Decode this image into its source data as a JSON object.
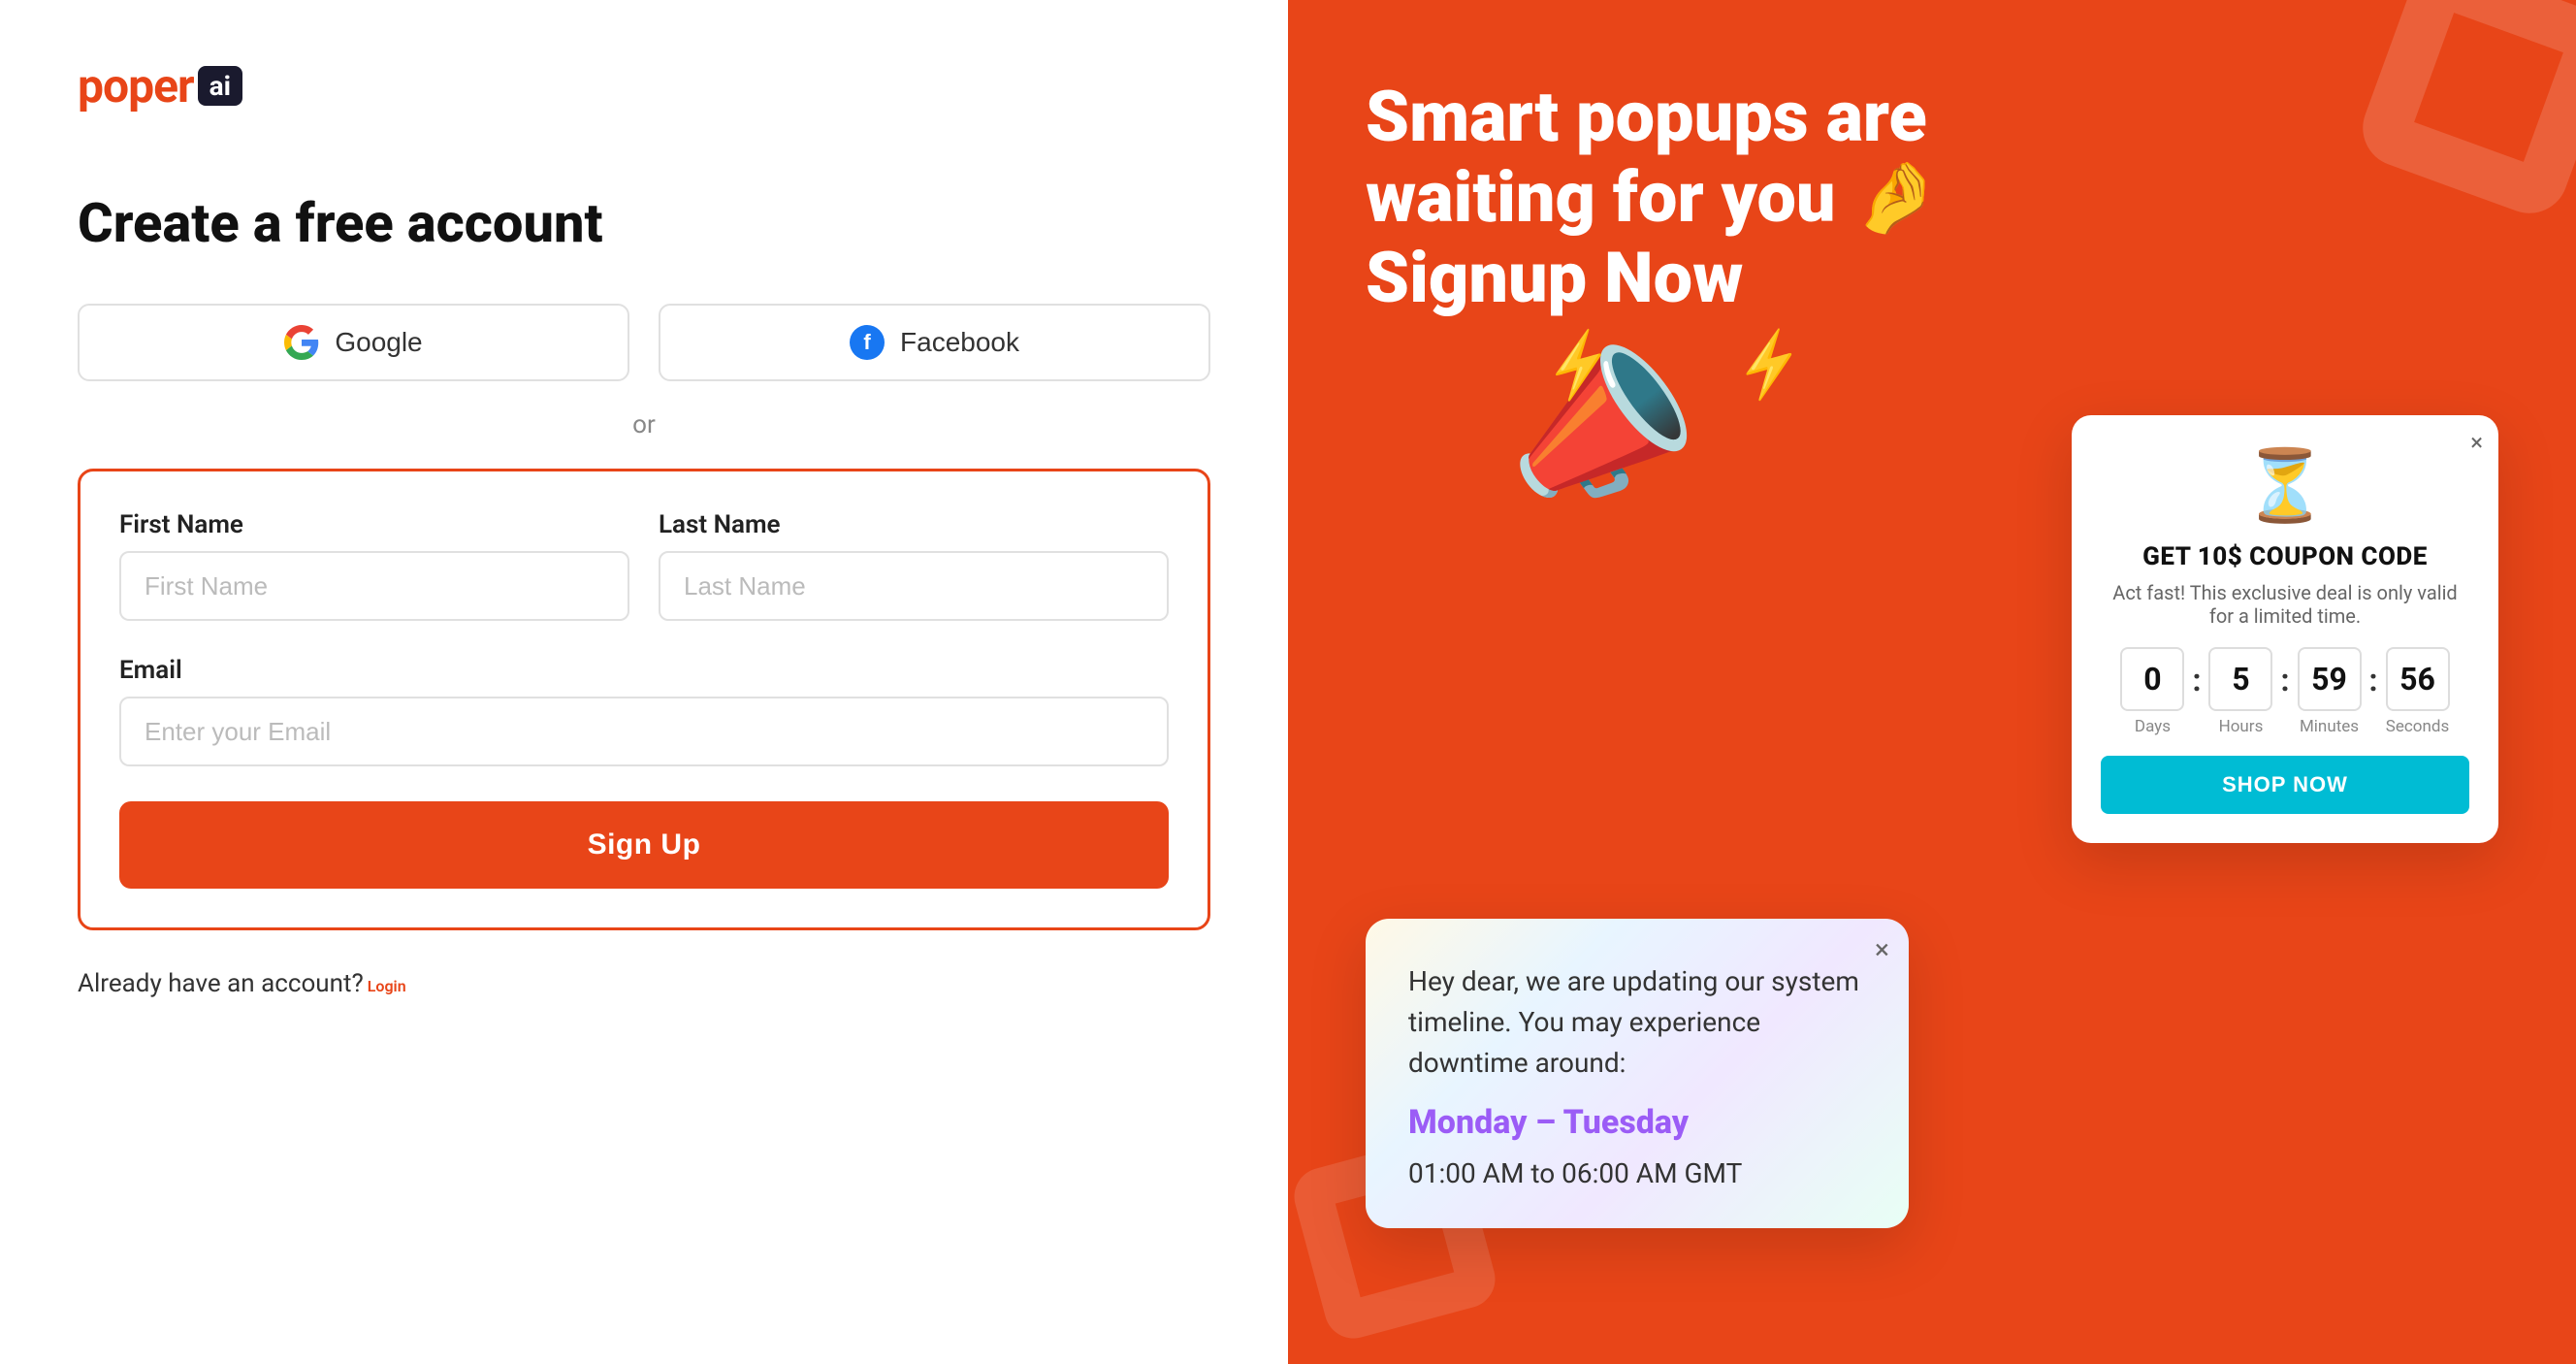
{
  "logo": {
    "text": "poper",
    "badge": "ai"
  },
  "left": {
    "title": "Create a free account",
    "google_btn": "Google",
    "facebook_btn": "Facebook",
    "divider": "or",
    "first_name_label": "First Name",
    "first_name_placeholder": "First Name",
    "last_name_label": "Last Name",
    "last_name_placeholder": "Last Name",
    "email_label": "Email",
    "email_placeholder": "Enter your Email",
    "signup_btn": "Sign Up",
    "login_text": "Already have an account?",
    "login_link": "Login"
  },
  "right": {
    "title": "Smart popups are waiting for you 🤌 Signup Now",
    "notification": {
      "body": "Hey dear, we are updating our system timeline. You may experience downtime around:",
      "day": "Monday – Tuesday",
      "time": "01:00 AM to 06:00 AM GMT"
    },
    "coupon": {
      "title": "GET 10$ COUPON CODE",
      "subtitle": "Act fast! This exclusive deal is only valid for a limited time.",
      "countdown": {
        "days": "0",
        "hours": "5",
        "minutes": "59",
        "seconds": "56",
        "days_label": "Days",
        "hours_label": "Hours",
        "minutes_label": "Minutes",
        "seconds_label": "Seconds"
      },
      "shop_btn": "SHOP NOW"
    }
  }
}
